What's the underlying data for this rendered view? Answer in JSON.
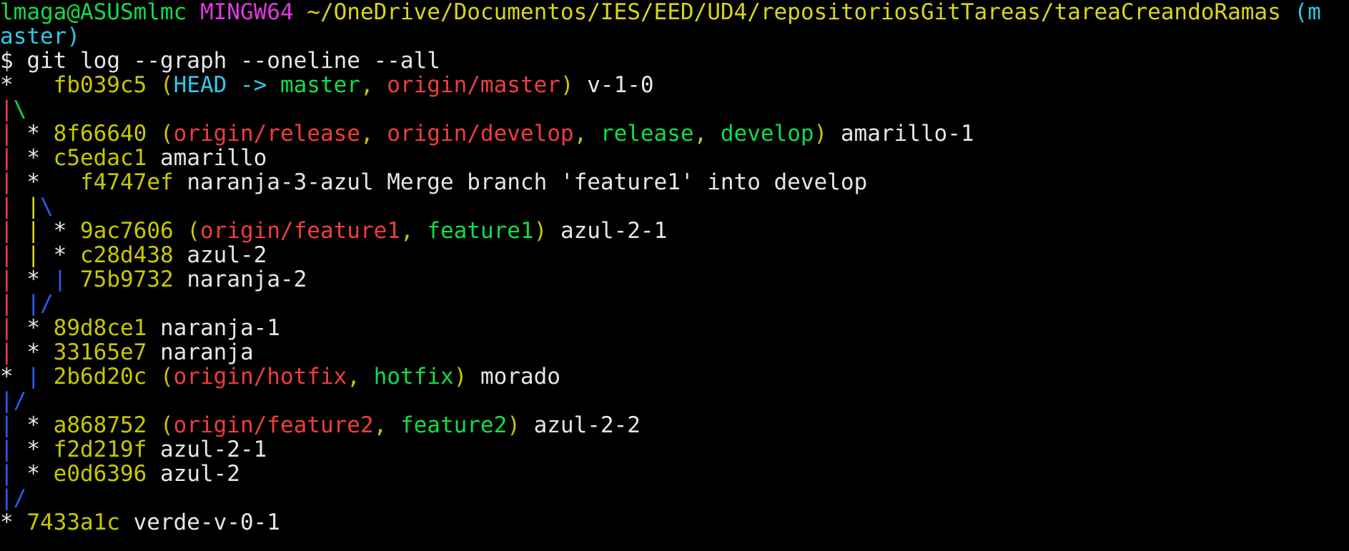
{
  "prompt": {
    "user_host": "lmaga@ASUSmlmc",
    "msystem": "MINGW64",
    "cwd": "~/OneDrive/Documentos/IES/EED/UD4/repositoriosGitTareas/tareaCreandoRamas",
    "branch_open": "(m",
    "branch_close": "aster)",
    "symbol": "$",
    "command": "git log --graph --oneline --all"
  },
  "colors": {
    "background": "#000000",
    "text": "#e6e6e6",
    "prompt_user": "#12dc4b",
    "prompt_msystem": "#e039e0",
    "prompt_path": "#d8d51a",
    "prompt_branch": "#2ec9e8",
    "hash": "#c8c800",
    "head": "#2ec9e8",
    "local_branch": "#12dc4b",
    "remote_branch": "#ef3d3d",
    "graph_red": "#ef3d3d",
    "graph_green": "#12dc4b",
    "graph_blue": "#2c5bf5"
  },
  "log_lines": [
    {
      "segments": [
        {
          "t": "*   ",
          "c": "default"
        },
        {
          "t": "fb039c5",
          "c": "hash"
        },
        {
          "t": " (",
          "c": "hash"
        },
        {
          "t": "HEAD -> ",
          "c": "cyan"
        },
        {
          "t": "master",
          "c": "green"
        },
        {
          "t": ", ",
          "c": "hash"
        },
        {
          "t": "origin/master",
          "c": "red"
        },
        {
          "t": ")",
          "c": "hash"
        },
        {
          "t": " v-1-0",
          "c": "default"
        }
      ]
    },
    {
      "segments": [
        {
          "t": "|",
          "c": "red"
        },
        {
          "t": "\\",
          "c": "green"
        }
      ]
    },
    {
      "segments": [
        {
          "t": "|",
          "c": "red"
        },
        {
          "t": " * ",
          "c": "default"
        },
        {
          "t": "8f66640",
          "c": "hash"
        },
        {
          "t": " (",
          "c": "hash"
        },
        {
          "t": "origin/release",
          "c": "red"
        },
        {
          "t": ", ",
          "c": "hash"
        },
        {
          "t": "origin/develop",
          "c": "red"
        },
        {
          "t": ", ",
          "c": "hash"
        },
        {
          "t": "release",
          "c": "green"
        },
        {
          "t": ", ",
          "c": "hash"
        },
        {
          "t": "develop",
          "c": "green"
        },
        {
          "t": ")",
          "c": "hash"
        },
        {
          "t": " amarillo-1",
          "c": "default"
        }
      ]
    },
    {
      "segments": [
        {
          "t": "|",
          "c": "red"
        },
        {
          "t": " * ",
          "c": "default"
        },
        {
          "t": "c5edac1",
          "c": "hash"
        },
        {
          "t": " amarillo",
          "c": "default"
        }
      ]
    },
    {
      "segments": [
        {
          "t": "|",
          "c": "red"
        },
        {
          "t": " *   ",
          "c": "default"
        },
        {
          "t": "f4747ef",
          "c": "hash"
        },
        {
          "t": " naranja-3-azul Merge branch 'feature1' into develop",
          "c": "default"
        }
      ]
    },
    {
      "segments": [
        {
          "t": "|",
          "c": "red"
        },
        {
          "t": " ",
          "c": "default"
        },
        {
          "t": "|",
          "c": "yellow"
        },
        {
          "t": "\\",
          "c": "blue"
        }
      ]
    },
    {
      "segments": [
        {
          "t": "|",
          "c": "red"
        },
        {
          "t": " ",
          "c": "default"
        },
        {
          "t": "|",
          "c": "yellow"
        },
        {
          "t": " * ",
          "c": "default"
        },
        {
          "t": "9ac7606",
          "c": "hash"
        },
        {
          "t": " (",
          "c": "hash"
        },
        {
          "t": "origin/feature1",
          "c": "red"
        },
        {
          "t": ", ",
          "c": "hash"
        },
        {
          "t": "feature1",
          "c": "green"
        },
        {
          "t": ")",
          "c": "hash"
        },
        {
          "t": " azul-2-1",
          "c": "default"
        }
      ]
    },
    {
      "segments": [
        {
          "t": "|",
          "c": "red"
        },
        {
          "t": " ",
          "c": "default"
        },
        {
          "t": "|",
          "c": "yellow"
        },
        {
          "t": " * ",
          "c": "default"
        },
        {
          "t": "c28d438",
          "c": "hash"
        },
        {
          "t": " azul-2",
          "c": "default"
        }
      ]
    },
    {
      "segments": [
        {
          "t": "|",
          "c": "red"
        },
        {
          "t": " * ",
          "c": "default"
        },
        {
          "t": "|",
          "c": "blue"
        },
        {
          "t": " ",
          "c": "default"
        },
        {
          "t": "75b9732",
          "c": "hash"
        },
        {
          "t": " naranja-2",
          "c": "default"
        }
      ]
    },
    {
      "segments": [
        {
          "t": "|",
          "c": "red"
        },
        {
          "t": " ",
          "c": "default"
        },
        {
          "t": "|/",
          "c": "blue"
        }
      ]
    },
    {
      "segments": [
        {
          "t": "|",
          "c": "red"
        },
        {
          "t": " * ",
          "c": "default"
        },
        {
          "t": "89d8ce1",
          "c": "hash"
        },
        {
          "t": " naranja-1",
          "c": "default"
        }
      ]
    },
    {
      "segments": [
        {
          "t": "|",
          "c": "red"
        },
        {
          "t": " * ",
          "c": "default"
        },
        {
          "t": "33165e7",
          "c": "hash"
        },
        {
          "t": " naranja",
          "c": "default"
        }
      ]
    },
    {
      "segments": [
        {
          "t": "* ",
          "c": "default"
        },
        {
          "t": "|",
          "c": "blue"
        },
        {
          "t": " ",
          "c": "default"
        },
        {
          "t": "2b6d20c",
          "c": "hash"
        },
        {
          "t": " (",
          "c": "hash"
        },
        {
          "t": "origin/hotfix",
          "c": "red"
        },
        {
          "t": ", ",
          "c": "hash"
        },
        {
          "t": "hotfix",
          "c": "green"
        },
        {
          "t": ")",
          "c": "hash"
        },
        {
          "t": " morado",
          "c": "default"
        }
      ]
    },
    {
      "segments": [
        {
          "t": "|/",
          "c": "blue"
        }
      ]
    },
    {
      "segments": [
        {
          "t": "|",
          "c": "blue"
        },
        {
          "t": " * ",
          "c": "default"
        },
        {
          "t": "a868752",
          "c": "hash"
        },
        {
          "t": " (",
          "c": "hash"
        },
        {
          "t": "origin/feature2",
          "c": "red"
        },
        {
          "t": ", ",
          "c": "hash"
        },
        {
          "t": "feature2",
          "c": "green"
        },
        {
          "t": ")",
          "c": "hash"
        },
        {
          "t": " azul-2-2",
          "c": "default"
        }
      ]
    },
    {
      "segments": [
        {
          "t": "|",
          "c": "blue"
        },
        {
          "t": " * ",
          "c": "default"
        },
        {
          "t": "f2d219f",
          "c": "hash"
        },
        {
          "t": " azul-2-1",
          "c": "default"
        }
      ]
    },
    {
      "segments": [
        {
          "t": "|",
          "c": "blue"
        },
        {
          "t": " * ",
          "c": "default"
        },
        {
          "t": "e0d6396",
          "c": "hash"
        },
        {
          "t": " azul-2",
          "c": "default"
        }
      ]
    },
    {
      "segments": [
        {
          "t": "|/",
          "c": "blue"
        }
      ]
    },
    {
      "segments": [
        {
          "t": "* ",
          "c": "default"
        },
        {
          "t": "7433a1c",
          "c": "hash"
        },
        {
          "t": " verde-v-0-1",
          "c": "default"
        }
      ]
    }
  ]
}
